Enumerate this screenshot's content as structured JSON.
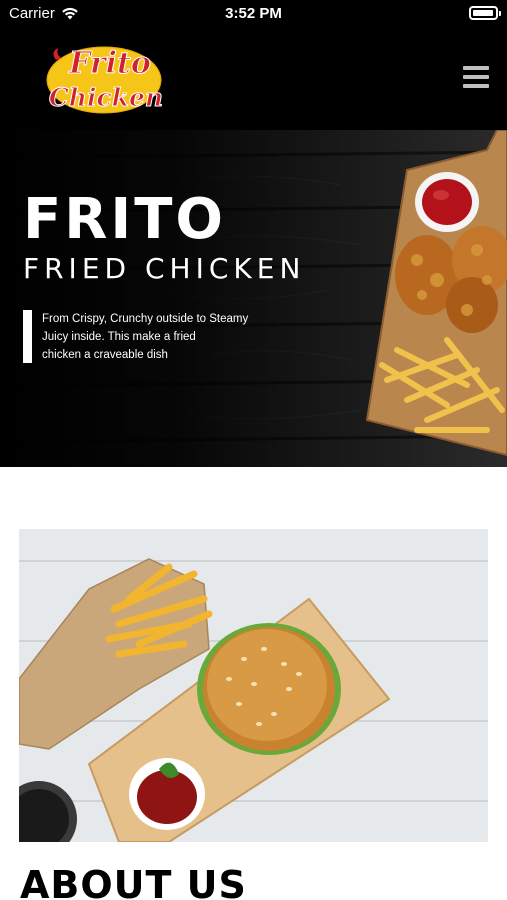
{
  "status_bar": {
    "carrier": "Carrier",
    "time": "3:52 PM"
  },
  "header": {
    "logo_line1": "Frito",
    "logo_line2": "Chicken",
    "menu_icon": "hamburger-menu-icon"
  },
  "hero": {
    "title": "FRITO",
    "subtitle": "FRIED CHICKEN",
    "description_lines": [
      "From Crispy, Crunchy outside to Steamy",
      "Juicy inside. This make a fried",
      "chicken a craveable dish"
    ]
  },
  "about": {
    "heading": "ABOUT US"
  },
  "colors": {
    "header_bg": "#000000",
    "logo_yellow": "#f5c518",
    "logo_red": "#d2202f",
    "page_bg": "#ffffff"
  }
}
